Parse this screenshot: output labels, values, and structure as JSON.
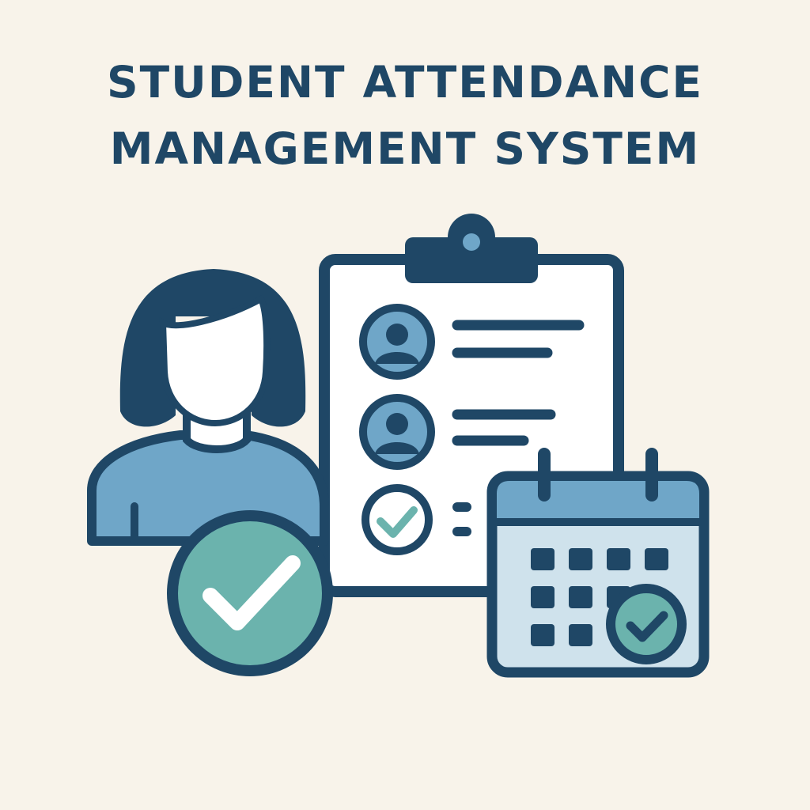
{
  "title": {
    "line1": "STUDENT ATTENDANCE",
    "line2": "MANAGEMENT SYSTEM"
  },
  "colors": {
    "background": "#f8f3ea",
    "navy": "#1f4766",
    "blue": "#6fa6c8",
    "teal": "#6bb3ad",
    "light_blue": "#cfe2ec",
    "white": "#ffffff"
  },
  "icons": {
    "student": "student-avatar-icon",
    "clipboard": "clipboard-icon",
    "calendar": "calendar-icon",
    "check": "check-badge-icon"
  }
}
